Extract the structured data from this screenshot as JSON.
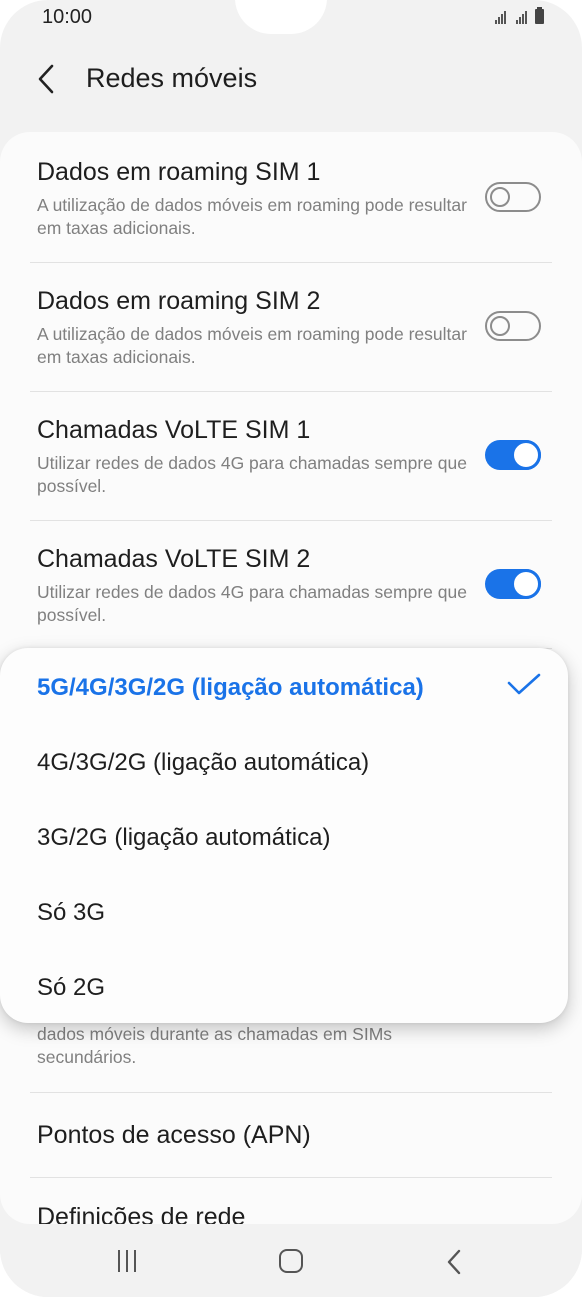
{
  "status_bar": {
    "time": "10:00"
  },
  "header": {
    "title": "Redes móveis"
  },
  "settings": [
    {
      "title": "Dados em roaming SIM 1",
      "subtitle": "A utilização de dados móveis em roaming pode resultar em taxas adicionais.",
      "toggle": "off"
    },
    {
      "title": "Dados em roaming SIM 2",
      "subtitle": "A utilização de dados móveis em roaming pode resultar em taxas adicionais.",
      "toggle": "off"
    },
    {
      "title": "Chamadas VoLTE SIM 1",
      "subtitle": "Utilizar redes de dados 4G para chamadas sempre que possível.",
      "toggle": "on"
    },
    {
      "title": "Chamadas VoLTE SIM 2",
      "subtitle": "Utilizar redes de dados 4G para chamadas sempre que possível.",
      "toggle": "on"
    }
  ],
  "partial_subtitle": "dados móveis durante as chamadas em SIMs secundários.",
  "apn_label": "Pontos de acesso (APN)",
  "network_settings_label": "Definições de rede",
  "network_mode_menu": {
    "options": [
      "5G/4G/3G/2G (ligação automática)",
      "4G/3G/2G (ligação automática)",
      "3G/2G (ligação automática)",
      "Só 3G",
      "Só 2G"
    ],
    "selected_index": 0
  },
  "colors": {
    "accent": "#1a73e8",
    "background": "#f2f2f2",
    "card": "#fbfbfb"
  },
  "icons": {
    "back": "chevron-left-icon",
    "check": "check-icon",
    "nav_recent": "recent-apps-icon",
    "nav_home": "home-icon",
    "nav_back": "back-icon"
  }
}
